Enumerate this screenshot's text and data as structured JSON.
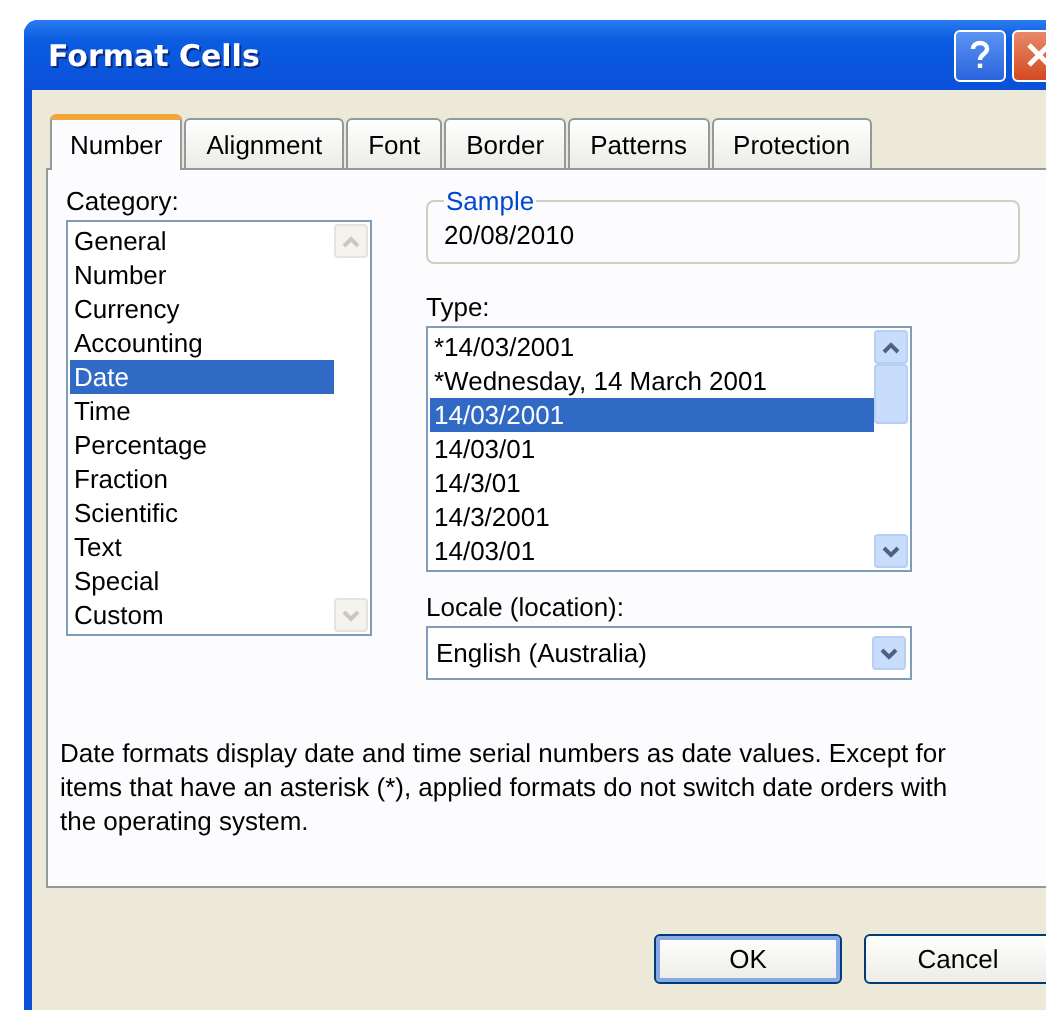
{
  "window": {
    "title": "Format Cells"
  },
  "tabs": [
    {
      "label": "Number",
      "selected": true
    },
    {
      "label": "Alignment",
      "selected": false
    },
    {
      "label": "Font",
      "selected": false
    },
    {
      "label": "Border",
      "selected": false
    },
    {
      "label": "Patterns",
      "selected": false
    },
    {
      "label": "Protection",
      "selected": false
    }
  ],
  "category": {
    "label": "Category:",
    "scrollbar_disabled": true,
    "items": [
      {
        "label": "General",
        "selected": false
      },
      {
        "label": "Number",
        "selected": false
      },
      {
        "label": "Currency",
        "selected": false
      },
      {
        "label": "Accounting",
        "selected": false
      },
      {
        "label": "Date",
        "selected": true
      },
      {
        "label": "Time",
        "selected": false
      },
      {
        "label": "Percentage",
        "selected": false
      },
      {
        "label": "Fraction",
        "selected": false
      },
      {
        "label": "Scientific",
        "selected": false
      },
      {
        "label": "Text",
        "selected": false
      },
      {
        "label": "Special",
        "selected": false
      },
      {
        "label": "Custom",
        "selected": false
      }
    ]
  },
  "sample": {
    "label": "Sample",
    "value": "20/08/2010"
  },
  "type": {
    "label": "Type:",
    "scrollbar_disabled": false,
    "items": [
      {
        "label": "*14/03/2001",
        "selected": false
      },
      {
        "label": "*Wednesday, 14 March 2001",
        "selected": false
      },
      {
        "label": "14/03/2001",
        "selected": true
      },
      {
        "label": "14/03/01",
        "selected": false
      },
      {
        "label": "14/3/01",
        "selected": false
      },
      {
        "label": "14/3/2001",
        "selected": false
      },
      {
        "label": "14/03/01",
        "selected": false
      }
    ]
  },
  "locale": {
    "label": "Locale (location):",
    "value": "English (Australia)"
  },
  "description": "Date formats display date and time serial numbers as date values. Except for items that have an asterisk (*), applied formats do not switch date orders with the operating system.",
  "buttons": [
    {
      "label": "OK",
      "default": true
    },
    {
      "label": "Cancel",
      "default": false
    }
  ]
}
